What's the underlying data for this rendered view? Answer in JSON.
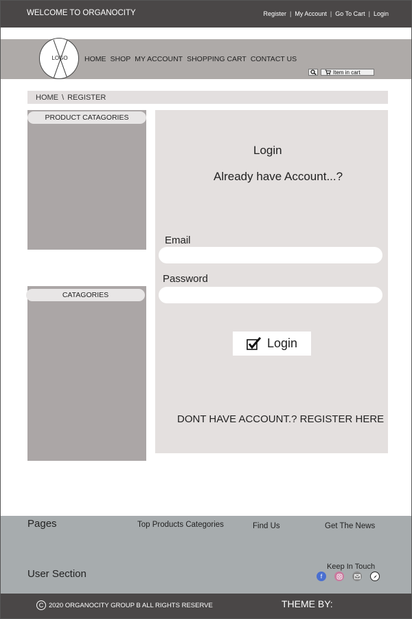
{
  "topbar": {
    "welcome": "WELCOME TO ORGANOCITY",
    "links": [
      "Register",
      "My Account",
      "Go To Cart",
      "Login"
    ],
    "separator": "|"
  },
  "header": {
    "logo_text": "LOGO",
    "nav": [
      "HOME",
      "SHOP",
      "MY ACCOUNT",
      "SHOPPING CART",
      "CONTACT US"
    ],
    "search_icon": "search-icon",
    "cart_label": "Item in cart"
  },
  "breadcrumb": {
    "home": "HOME",
    "separator": "\\",
    "current": "REGISTER"
  },
  "sidebar": {
    "product_categories": "PRODUCT CATAGORIES",
    "categories": "CATAGORIES"
  },
  "login": {
    "title": "Login",
    "subtitle": "Already have Account...?",
    "email_label": "Email",
    "email_value": "",
    "password_label": "Password",
    "password_value": "",
    "button_label": "Login",
    "register_link": "DONT HAVE ACCOUNT.? REGISTER HERE"
  },
  "footer": {
    "pages": "Pages",
    "top_products": "Top Products Categories",
    "find_us": "Find Us",
    "get_news": "Get The News",
    "user_section": "User Section",
    "keep_in_touch": "Keep In Touch",
    "social_icons": [
      "facebook-icon",
      "instagram-icon",
      "email-icon",
      "compass-icon"
    ]
  },
  "bottombar": {
    "copyright": "2020 ORGANOCITY GROUP B ALL RIGHTS RESERVE",
    "theme_by": "THEME BY:"
  },
  "colors": {
    "dark_bar": "#4a4747",
    "nav_band": "#aeaaa8",
    "sidebar": "#aba6a6",
    "panel": "#e4e0df",
    "footer": "#a7acae"
  }
}
